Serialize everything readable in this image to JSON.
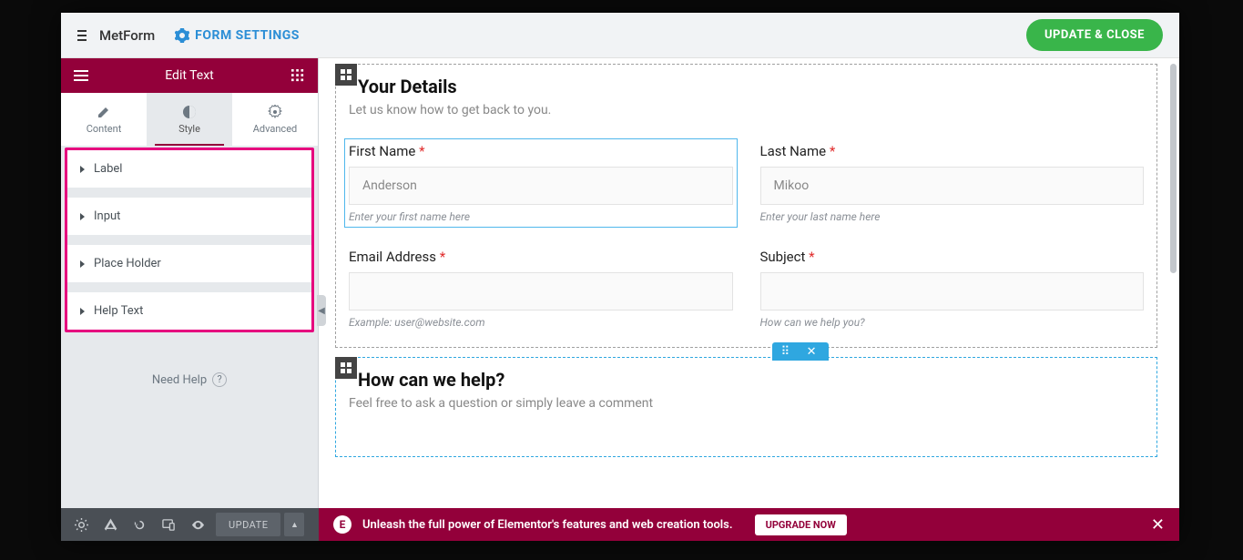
{
  "topbar": {
    "brand": "MetForm",
    "form_settings": "FORM SETTINGS",
    "update_close": "UPDATE & CLOSE"
  },
  "sidebar": {
    "title": "Edit Text",
    "tabs": {
      "content": "Content",
      "style": "Style",
      "advanced": "Advanced"
    },
    "accordion": [
      "Label",
      "Input",
      "Place Holder",
      "Help Text"
    ],
    "need_help": "Need Help"
  },
  "form": {
    "sec1_title": "Your Details",
    "sec1_sub": "Let us know how to get back to you.",
    "fields": {
      "first_name": {
        "label": "First Name",
        "value": "Anderson",
        "help": "Enter your first name here"
      },
      "last_name": {
        "label": "Last Name",
        "value": "Mikoo",
        "help": "Enter your last name here"
      },
      "email": {
        "label": "Email Address",
        "value": "",
        "help": "Example: user@website.com"
      },
      "subject": {
        "label": "Subject",
        "value": "",
        "help": "How can we help you?"
      }
    },
    "sec2_title": "How can we help?",
    "sec2_sub": "Feel free to ask a question or simply leave a comment"
  },
  "bottombar": {
    "update": "UPDATE",
    "promo": "Unleash the full power of Elementor's features and web creation tools.",
    "upgrade": "UPGRADE NOW"
  }
}
